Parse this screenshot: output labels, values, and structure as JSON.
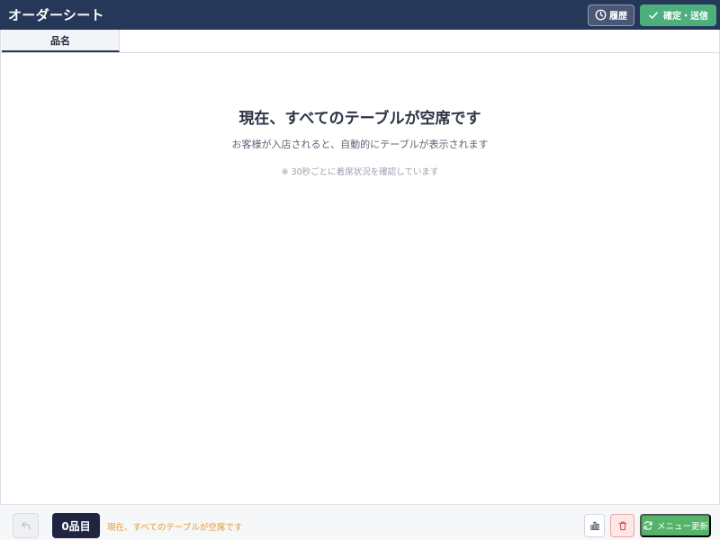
{
  "header": {
    "title": "オーダーシート",
    "history_label": "履歴",
    "confirm_label": "確定・送信"
  },
  "tabs": [
    {
      "label": "品名",
      "active": true
    }
  ],
  "main": {
    "empty_title": "現在、すべてのテーブルが空席です",
    "empty_subtitle": "お客様が入店されると、自動的にテーブルが表示されます",
    "empty_note": "※ 30秒ごとに着席状況を確認しています"
  },
  "footer": {
    "item_count": "0品目",
    "status_message": "現在、すべてのテーブルが空席です",
    "menu_update_label": "メニュー更新"
  },
  "icons": {
    "history": "clock-icon",
    "confirm": "check-icon",
    "undo": "undo-icon",
    "stats": "bar-chart-icon",
    "delete": "trash-icon",
    "refresh": "refresh-icon"
  },
  "colors": {
    "header_bg": "#263859",
    "confirm_green": "#4caf7c",
    "badge_dark": "#1f2440",
    "status_orange": "#e39a2c",
    "delete_red": "#e04848",
    "update_green": "#56b46a"
  }
}
